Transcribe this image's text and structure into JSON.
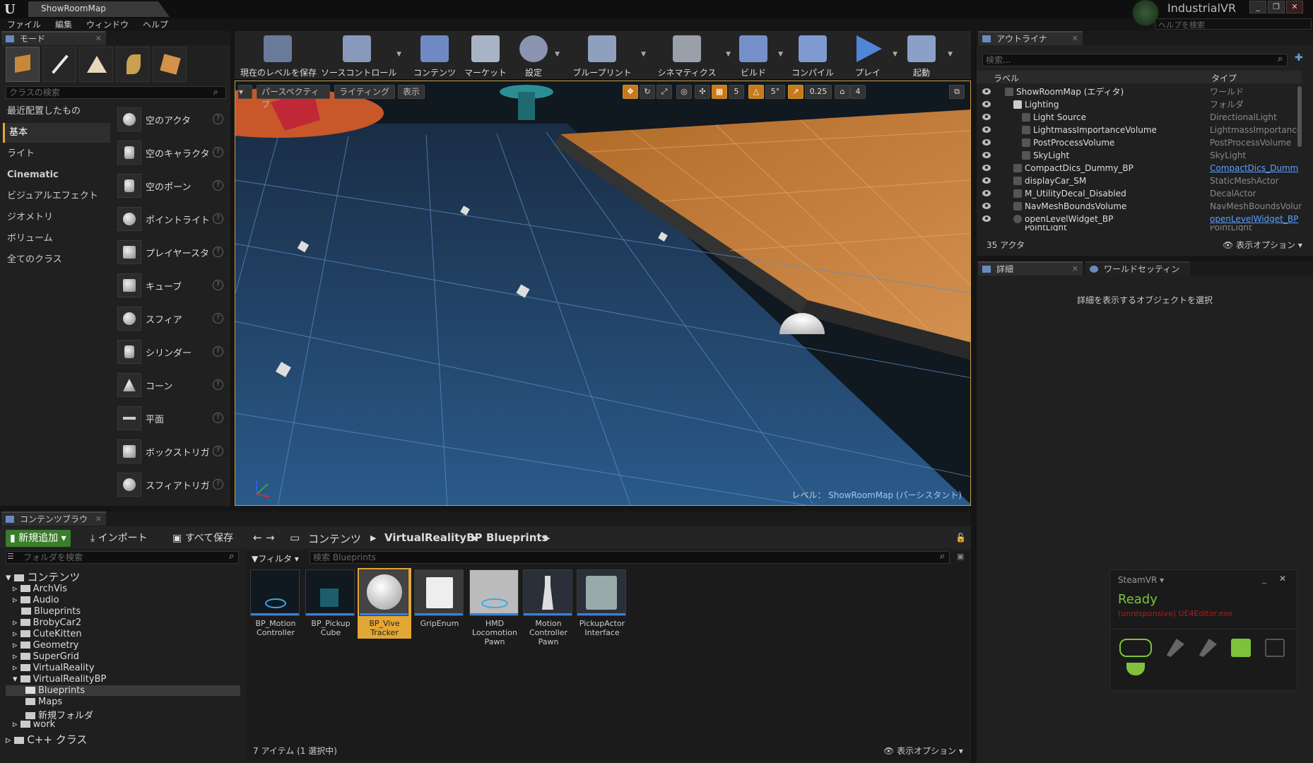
{
  "window": {
    "tab_title": "ShowRoomMap",
    "project_name": "IndustrialVR",
    "help_search_placeholder": "ヘルプを検索"
  },
  "menu": [
    "ファイル",
    "編集",
    "ウィンドウ",
    "ヘルプ"
  ],
  "modes": {
    "tab_label": "モード",
    "search_placeholder": "クラスの検索",
    "categories": [
      "最近配置したもの",
      "基本",
      "ライト",
      "Cinematic",
      "ビジュアルエフェクト",
      "ジオメトリ",
      "ボリューム",
      "全てのクラス"
    ],
    "items": [
      "空のアクタ",
      "空のキャラクタ",
      "空のポーン",
      "ポイントライト",
      "プレイヤースタ",
      "キューブ",
      "スフィア",
      "シリンダー",
      "コーン",
      "平面",
      "ボックストリガ",
      "スフィアトリガ"
    ]
  },
  "toolbar": [
    "現在のレベルを保存",
    "ソースコントロール",
    "コンテンツ",
    "マーケット",
    "設定",
    "ブループリント",
    "シネマティクス",
    "ビルド",
    "コンパイル",
    "プレイ",
    "起動"
  ],
  "viewport": {
    "perspective": "パースペクティブ",
    "lighting": "ライティング",
    "show": "表示",
    "grid_snap": "5",
    "rot_snap": "5°",
    "scale_snap": "0.25",
    "cam_speed": "4",
    "level_prefix": "レベル：",
    "level_name": "ShowRoomMap (パーシスタント)"
  },
  "outliner": {
    "tab_label": "アウトライナ",
    "search_placeholder": "検索...",
    "col_label": "ラベル",
    "col_type": "タイプ",
    "rows": [
      {
        "label": "ShowRoomMap (エディタ)",
        "type": "ワールド"
      },
      {
        "label": "Lighting",
        "type": "フォルダ"
      },
      {
        "label": "Light Source",
        "type": "DirectionalLight"
      },
      {
        "label": "LightmassImportanceVolume",
        "type": "LightmassImportanceV"
      },
      {
        "label": "PostProcessVolume",
        "type": "PostProcessVolume"
      },
      {
        "label": "SkyLight",
        "type": "SkyLight"
      },
      {
        "label": "CompactDics_Dummy_BP",
        "type": "CompactDics_Dumm"
      },
      {
        "label": "displayCar_SM",
        "type": "StaticMeshActor"
      },
      {
        "label": "M_UtilityDecal_Disabled",
        "type": "DecalActor"
      },
      {
        "label": "NavMeshBoundsVolume",
        "type": "NavMeshBoundsVolun"
      },
      {
        "label": "openLevelWidget_BP",
        "type": "openLevelWidget_BP"
      },
      {
        "label": "PointLight",
        "type": "PointLight"
      }
    ],
    "count": "35 アクタ",
    "view_options": "表示オプション"
  },
  "details": {
    "tab_details": "詳細",
    "tab_world": "ワールドセッティン",
    "empty_text": "詳細を表示するオブジェクトを選択"
  },
  "content_browser": {
    "tab_label": "コンテンツブラウ",
    "new_button": "新規追加",
    "import_button": "インポート",
    "save_all_button": "すべて保存",
    "path": [
      "コンテンツ",
      "VirtualRealityBP",
      "Blueprints"
    ],
    "folder_search_placeholder": "フォルダを検索",
    "filter_label": "フィルタ",
    "asset_search_placeholder": "検索 Blueprints",
    "tree": [
      "コンテンツ",
      "ArchVis",
      "Audio",
      "Blueprints",
      "BrobyCar2",
      "CuteKitten",
      "Geometry",
      "SuperGrid",
      "VirtualReality",
      "VirtualRealityBP",
      "Blueprints",
      "Maps",
      "新規フォルダ",
      "work",
      "C++ クラス"
    ],
    "assets": [
      {
        "name": "BP_Motion Controller"
      },
      {
        "name": "BP_Pickup Cube"
      },
      {
        "name": "BP_Vive Tracker"
      },
      {
        "name": "GripEnum"
      },
      {
        "name": "HMD Locomotion Pawn"
      },
      {
        "name": "Motion Controller Pawn"
      },
      {
        "name": "PickupActor Interface"
      }
    ],
    "items_count": "7 アイテム (1 選択中)",
    "view_options": "表示オプション"
  },
  "steamvr": {
    "title": "SteamVR",
    "status": "Ready",
    "warning": "(unresponsive) UE4Editor.exe"
  },
  "colors": {
    "accent": "#e2a735",
    "steamvr_ready": "#7ec23c",
    "new_button": "#3a7d2c"
  }
}
